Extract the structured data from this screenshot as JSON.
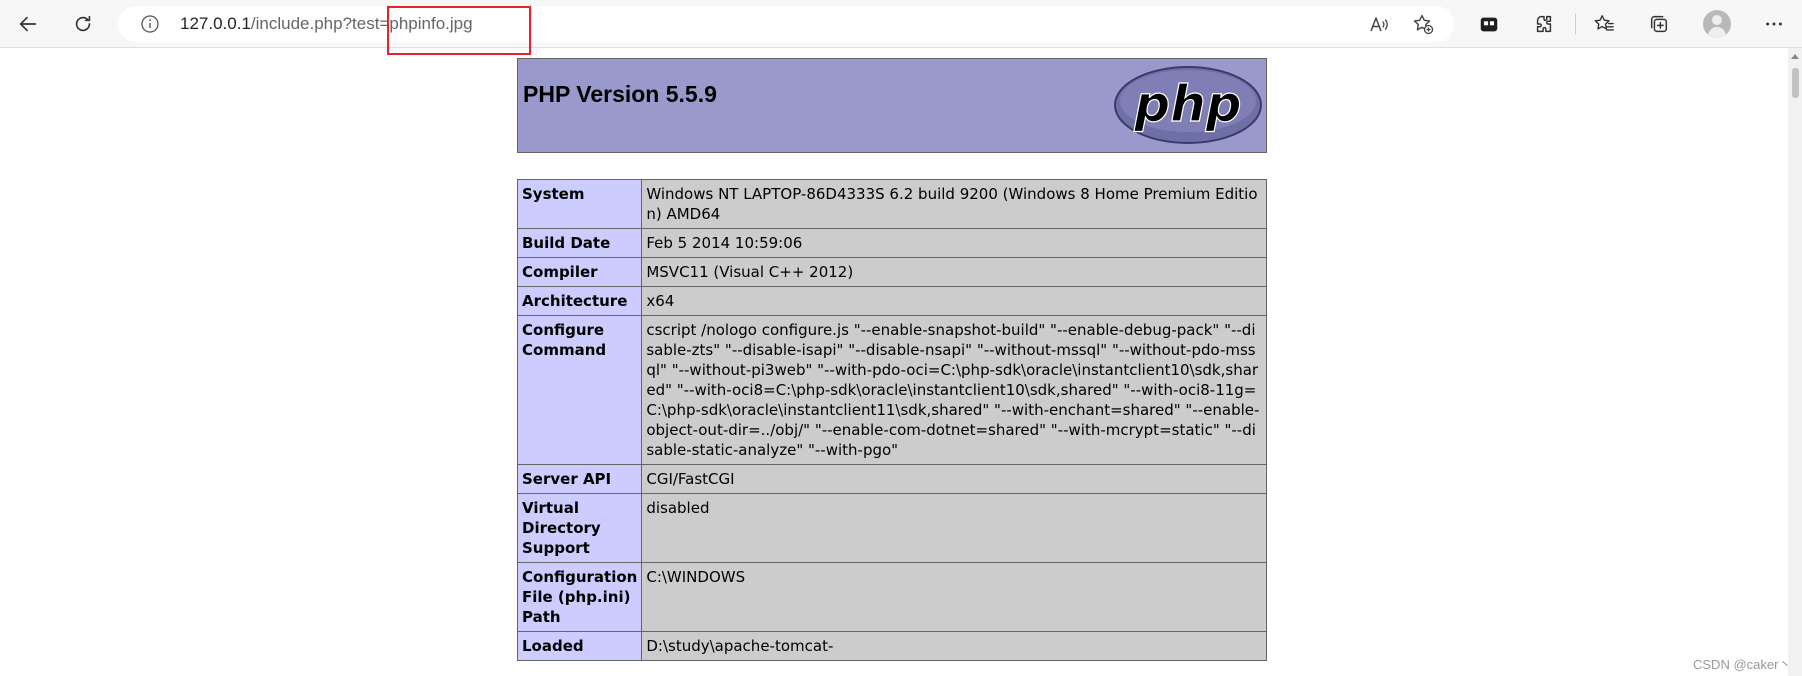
{
  "browser": {
    "url_host": "127.0.0.1",
    "url_rest": "/include.php?test=phpinfo.jpg",
    "icons": [
      "back-icon",
      "refresh-icon",
      "info-icon",
      "read-aloud-icon",
      "favorite-add-icon",
      "tab-actions-icon",
      "extensions-icon",
      "favorites-icon",
      "collections-icon",
      "profile-icon",
      "more-icon"
    ]
  },
  "php": {
    "title": "PHP Version 5.5.9",
    "logo_text": "php",
    "rows": [
      {
        "label": "System",
        "value": "Windows NT LAPTOP-86D4333S 6.2 build 9200 (Windows 8 Home Premium Edition) AMD64"
      },
      {
        "label": "Build Date",
        "value": "Feb 5 2014 10:59:06"
      },
      {
        "label": "Compiler",
        "value": "MSVC11 (Visual C++ 2012)"
      },
      {
        "label": "Architecture",
        "value": "x64"
      },
      {
        "label": "Configure Command",
        "value": "cscript /nologo configure.js \"--enable-snapshot-build\" \"--enable-debug-pack\" \"--disable-zts\" \"--disable-isapi\" \"--disable-nsapi\" \"--without-mssql\" \"--without-pdo-mssql\" \"--without-pi3web\" \"--with-pdo-oci=C:\\php-sdk\\oracle\\instantclient10\\sdk,shared\" \"--with-oci8=C:\\php-sdk\\oracle\\instantclient10\\sdk,shared\" \"--with-oci8-11g=C:\\php-sdk\\oracle\\instantclient11\\sdk,shared\" \"--with-enchant=shared\" \"--enable-object-out-dir=../obj/\" \"--enable-com-dotnet=shared\" \"--with-mcrypt=static\" \"--disable-static-analyze\" \"--with-pgo\""
      },
      {
        "label": "Server API",
        "value": "CGI/FastCGI"
      },
      {
        "label": "Virtual Directory Support",
        "value": "disabled"
      },
      {
        "label": "Configuration File (php.ini) Path",
        "value": "C:\\WINDOWS"
      },
      {
        "label": "Loaded",
        "value": "D:\\study\\apache-tomcat-"
      }
    ]
  },
  "watermark": "CSDN @caker丶",
  "colors": {
    "header_bg": "#9999cc",
    "label_bg": "#ccccff",
    "value_bg": "#cccccc",
    "highlight": "#e8222a"
  }
}
